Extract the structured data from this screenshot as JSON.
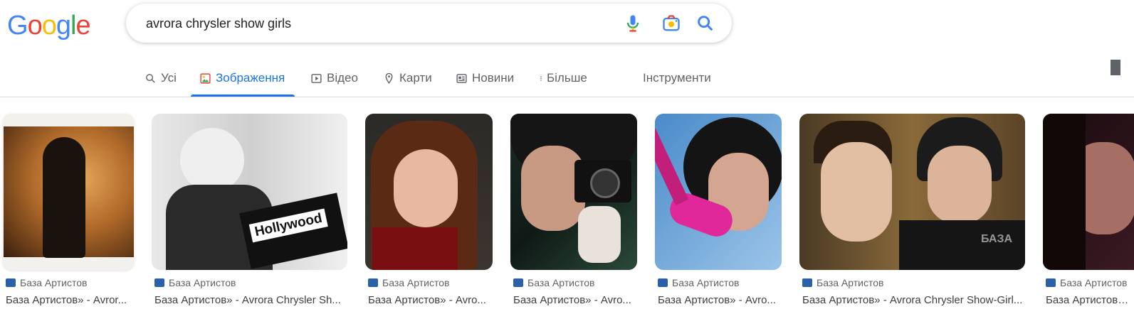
{
  "logo": {
    "g1": "G",
    "o1": "o",
    "o2": "o",
    "g2": "g",
    "l": "l",
    "e": "e"
  },
  "search": {
    "query": "avrora chrysler show girls"
  },
  "icons": {
    "mic": "microphone-icon",
    "camera": "camera-lens-icon",
    "search": "magnifier-icon"
  },
  "tabs": [
    {
      "label": "Усі",
      "icon": "search-icon"
    },
    {
      "label": "Зображення",
      "icon": "image-icon",
      "active": true
    },
    {
      "label": "Відео",
      "icon": "play-icon"
    },
    {
      "label": "Карти",
      "icon": "map-pin-icon"
    },
    {
      "label": "Новини",
      "icon": "news-icon"
    },
    {
      "label": "Більше",
      "icon": "more-vert-icon"
    }
  ],
  "tools_label": "Інструменти",
  "results": [
    {
      "source": "База Артистов",
      "title": "База Артистов» - Avror..."
    },
    {
      "source": "База Артистов",
      "title": "База Артистов» - Avrora Chrysler Sh..."
    },
    {
      "source": "База Артистов",
      "title": "База Артистов» - Avro..."
    },
    {
      "source": "База Артистов",
      "title": "База Артистов» - Avro..."
    },
    {
      "source": "База Артистов",
      "title": "База Артистов» - Avro..."
    },
    {
      "source": "База Артистов",
      "title": "База Артистов» - Avrora Chrysler Show-Girl..."
    },
    {
      "source": "База Артистов",
      "title": "База Артистов» ..."
    }
  ],
  "image_texts": {
    "clapper": "Hollywood",
    "watermark": "БАЗА"
  },
  "colors": {
    "accent": "#1a73e8",
    "tab_text": "#5f6368"
  }
}
